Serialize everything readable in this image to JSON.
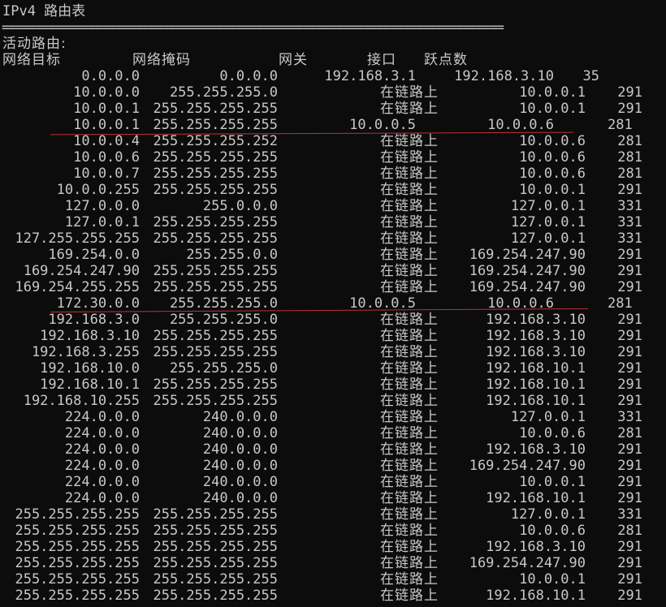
{
  "console": {
    "title": "IPv4 路由表",
    "separator": "===========================================================================",
    "caption": "活动路由:",
    "headers": {
      "destination": "网络目标",
      "netmask": "网络掩码",
      "gateway": "网关",
      "interface": "接口",
      "metric": "跃点数"
    },
    "rows": [
      {
        "destination": "0.0.0.0",
        "netmask": "0.0.0.0",
        "gateway": "192.168.3.1",
        "interface": "192.168.3.10",
        "metric": "35"
      },
      {
        "destination": "10.0.0.0",
        "netmask": "255.255.255.0",
        "gateway": "在链路上",
        "interface": "10.0.0.1",
        "metric": "291"
      },
      {
        "destination": "10.0.0.1",
        "netmask": "255.255.255.255",
        "gateway": "在链路上",
        "interface": "10.0.0.1",
        "metric": "291"
      },
      {
        "destination": "10.0.0.1",
        "netmask": "255.255.255.255",
        "gateway": "10.0.0.5",
        "interface": "10.0.0.6",
        "metric": "281"
      },
      {
        "destination": "10.0.0.4",
        "netmask": "255.255.255.252",
        "gateway": "在链路上",
        "interface": "10.0.0.6",
        "metric": "281"
      },
      {
        "destination": "10.0.0.6",
        "netmask": "255.255.255.255",
        "gateway": "在链路上",
        "interface": "10.0.0.6",
        "metric": "281"
      },
      {
        "destination": "10.0.0.7",
        "netmask": "255.255.255.255",
        "gateway": "在链路上",
        "interface": "10.0.0.6",
        "metric": "281"
      },
      {
        "destination": "10.0.0.255",
        "netmask": "255.255.255.255",
        "gateway": "在链路上",
        "interface": "10.0.0.1",
        "metric": "291"
      },
      {
        "destination": "127.0.0.0",
        "netmask": "255.0.0.0",
        "gateway": "在链路上",
        "interface": "127.0.0.1",
        "metric": "331"
      },
      {
        "destination": "127.0.0.1",
        "netmask": "255.255.255.255",
        "gateway": "在链路上",
        "interface": "127.0.0.1",
        "metric": "331"
      },
      {
        "destination": "127.255.255.255",
        "netmask": "255.255.255.255",
        "gateway": "在链路上",
        "interface": "127.0.0.1",
        "metric": "331"
      },
      {
        "destination": "169.254.0.0",
        "netmask": "255.255.0.0",
        "gateway": "在链路上",
        "interface": "169.254.247.90",
        "metric": "291"
      },
      {
        "destination": "169.254.247.90",
        "netmask": "255.255.255.255",
        "gateway": "在链路上",
        "interface": "169.254.247.90",
        "metric": "291"
      },
      {
        "destination": "169.254.255.255",
        "netmask": "255.255.255.255",
        "gateway": "在链路上",
        "interface": "169.254.247.90",
        "metric": "291"
      },
      {
        "destination": "172.30.0.0",
        "netmask": "255.255.255.0",
        "gateway": "10.0.0.5",
        "interface": "10.0.0.6",
        "metric": "281"
      },
      {
        "destination": "192.168.3.0",
        "netmask": "255.255.255.0",
        "gateway": "在链路上",
        "interface": "192.168.3.10",
        "metric": "291"
      },
      {
        "destination": "192.168.3.10",
        "netmask": "255.255.255.255",
        "gateway": "在链路上",
        "interface": "192.168.3.10",
        "metric": "291"
      },
      {
        "destination": "192.168.3.255",
        "netmask": "255.255.255.255",
        "gateway": "在链路上",
        "interface": "192.168.3.10",
        "metric": "291"
      },
      {
        "destination": "192.168.10.0",
        "netmask": "255.255.255.0",
        "gateway": "在链路上",
        "interface": "192.168.10.1",
        "metric": "291"
      },
      {
        "destination": "192.168.10.1",
        "netmask": "255.255.255.255",
        "gateway": "在链路上",
        "interface": "192.168.10.1",
        "metric": "291"
      },
      {
        "destination": "192.168.10.255",
        "netmask": "255.255.255.255",
        "gateway": "在链路上",
        "interface": "192.168.10.1",
        "metric": "291"
      },
      {
        "destination": "224.0.0.0",
        "netmask": "240.0.0.0",
        "gateway": "在链路上",
        "interface": "127.0.0.1",
        "metric": "331"
      },
      {
        "destination": "224.0.0.0",
        "netmask": "240.0.0.0",
        "gateway": "在链路上",
        "interface": "10.0.0.6",
        "metric": "281"
      },
      {
        "destination": "224.0.0.0",
        "netmask": "240.0.0.0",
        "gateway": "在链路上",
        "interface": "192.168.3.10",
        "metric": "291"
      },
      {
        "destination": "224.0.0.0",
        "netmask": "240.0.0.0",
        "gateway": "在链路上",
        "interface": "169.254.247.90",
        "metric": "291"
      },
      {
        "destination": "224.0.0.0",
        "netmask": "240.0.0.0",
        "gateway": "在链路上",
        "interface": "10.0.0.1",
        "metric": "291"
      },
      {
        "destination": "224.0.0.0",
        "netmask": "240.0.0.0",
        "gateway": "在链路上",
        "interface": "192.168.10.1",
        "metric": "291"
      },
      {
        "destination": "255.255.255.255",
        "netmask": "255.255.255.255",
        "gateway": "在链路上",
        "interface": "127.0.0.1",
        "metric": "331"
      },
      {
        "destination": "255.255.255.255",
        "netmask": "255.255.255.255",
        "gateway": "在链路上",
        "interface": "10.0.0.6",
        "metric": "281"
      },
      {
        "destination": "255.255.255.255",
        "netmask": "255.255.255.255",
        "gateway": "在链路上",
        "interface": "192.168.3.10",
        "metric": "291"
      },
      {
        "destination": "255.255.255.255",
        "netmask": "255.255.255.255",
        "gateway": "在链路上",
        "interface": "169.254.247.90",
        "metric": "291"
      },
      {
        "destination": "255.255.255.255",
        "netmask": "255.255.255.255",
        "gateway": "在链路上",
        "interface": "10.0.0.1",
        "metric": "291"
      },
      {
        "destination": "255.255.255.255",
        "netmask": "255.255.255.255",
        "gateway": "在链路上",
        "interface": "192.168.10.1",
        "metric": "291"
      }
    ]
  },
  "annotations": {
    "underline_color": "#c0303a"
  }
}
